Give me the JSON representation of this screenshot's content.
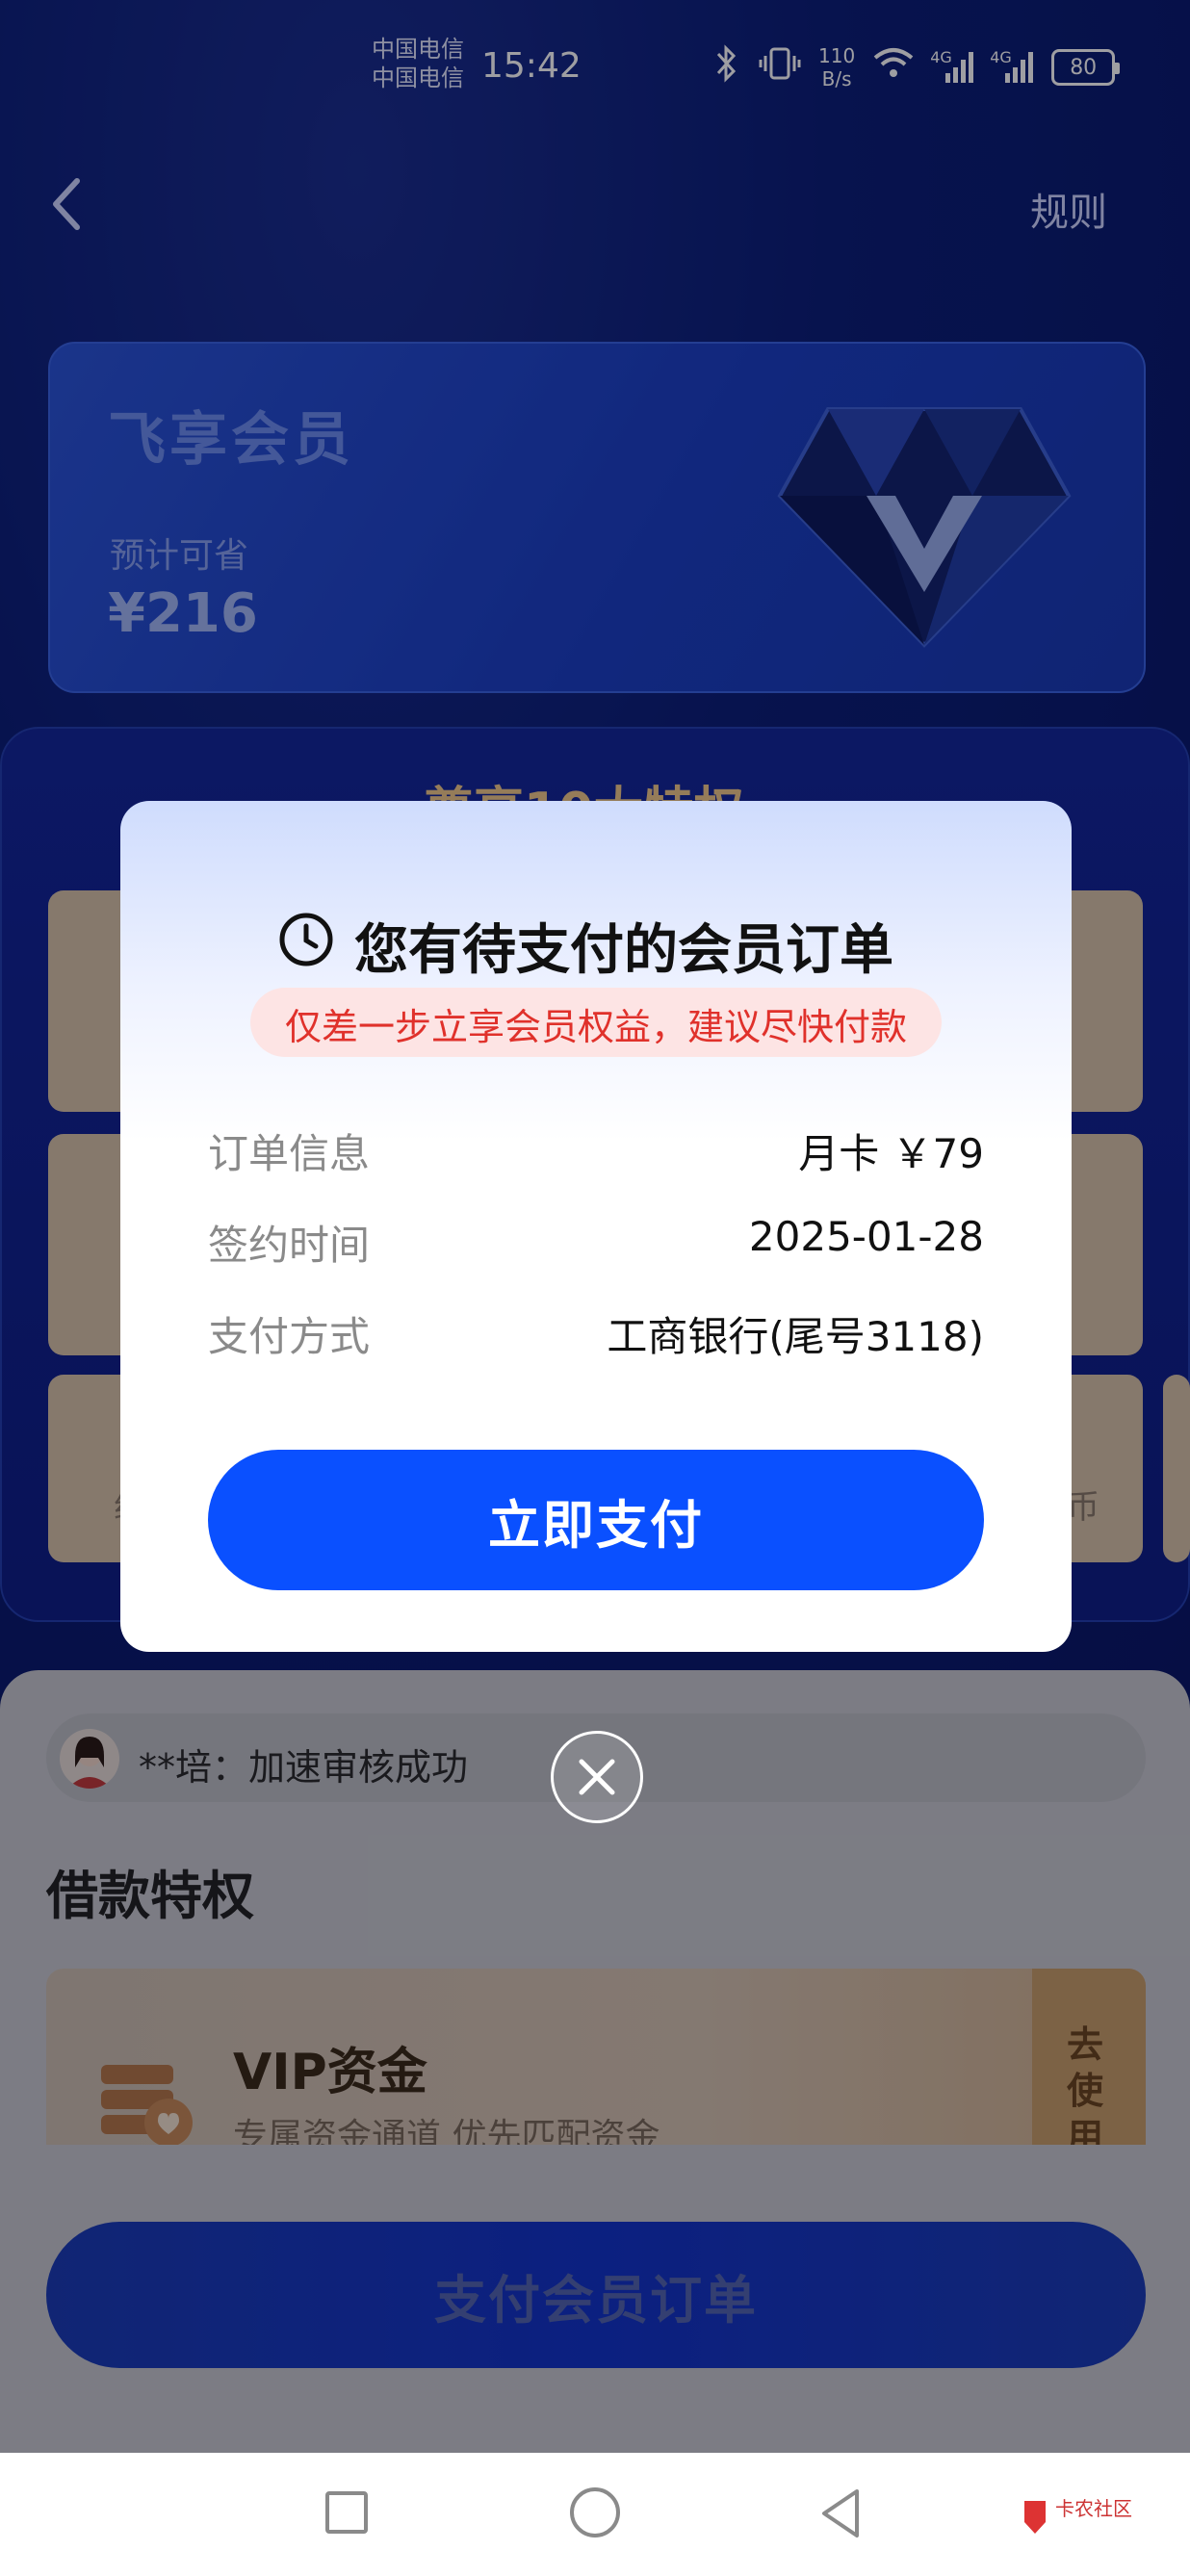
{
  "status_bar": {
    "carrier_1": "中国电信",
    "carrier_2": "中国电信",
    "time": "15:42",
    "net_speed_value": "110",
    "net_speed_unit": "B/s",
    "network_1": "4G",
    "network_2": "4G",
    "battery": "80"
  },
  "header": {
    "back_icon": "chevron-left-icon",
    "rules_label": "规则"
  },
  "member_card": {
    "title": "飞享会员",
    "savings_label": "预计可省",
    "savings_amount": "¥216",
    "icon": "diamond-icon"
  },
  "privileges": {
    "title": "尊享10大特权",
    "partial_text_left": "组",
    "partial_text_right": "币"
  },
  "ticker": {
    "text": "**培：加速审核成功"
  },
  "loan_section": {
    "title": "借款特权",
    "vip_title": "VIP资金",
    "vip_subtitle": "专属资金通道 优先匹配资金",
    "use_label": "去使用"
  },
  "bottom_button": {
    "label": "支付会员订单"
  },
  "modal": {
    "title": "您有待支付的会员订单",
    "notice": "仅差一步立享会员权益，建议尽快付款",
    "rows": [
      {
        "label": "订单信息",
        "value": "月卡 ￥79"
      },
      {
        "label": "签约时间",
        "value": "2025-01-28"
      },
      {
        "label": "支付方式",
        "value": "工商银行(尾号3118)"
      }
    ],
    "pay_label": "立即支付",
    "close_icon": "close-icon"
  },
  "nav_bar": {
    "recent_icon": "square-icon",
    "home_icon": "circle-icon",
    "back_icon": "triangle-back-icon"
  },
  "watermark": {
    "text": "卡农社区"
  },
  "colors": {
    "primary": "#0a50ff",
    "notice_text": "#e0312b",
    "notice_bg": "#fde4e4"
  }
}
